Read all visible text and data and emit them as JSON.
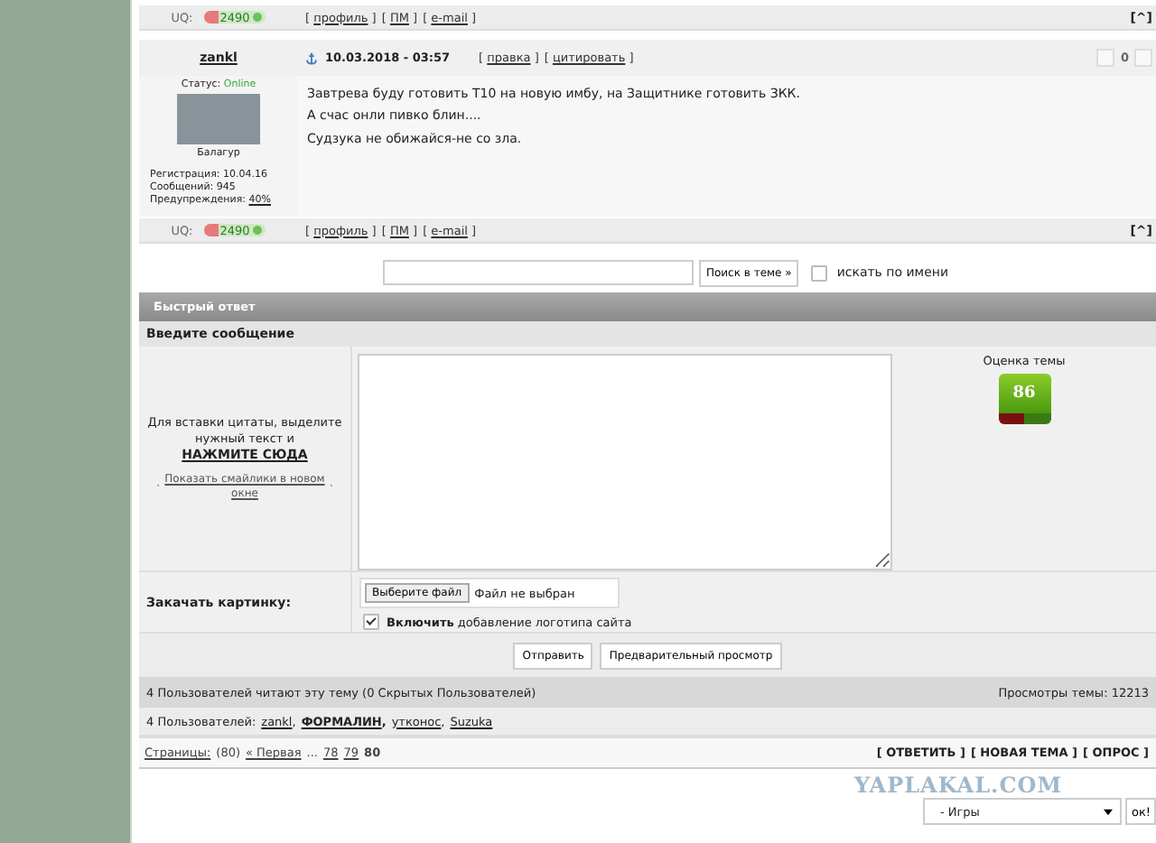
{
  "top_bar": {
    "uq_label": "UQ:",
    "rating": "2490",
    "links": [
      {
        "open": "[",
        "label": "профиль",
        "close": "]"
      },
      {
        "open": "[",
        "label": "ПМ",
        "close": "]"
      },
      {
        "open": "[",
        "label": "e-mail",
        "close": "]"
      }
    ],
    "top_link": "[^]"
  },
  "post": {
    "username": "zankl",
    "date": "10.03.2018 - 03:57",
    "actions": [
      {
        "open": "[",
        "label": "правка",
        "close": "]"
      },
      {
        "open": "[",
        "label": "цитировать",
        "close": "]"
      }
    ],
    "votes": "0",
    "status_label": "Статус:",
    "status": "Online",
    "rank": "Балагур",
    "stats": [
      "Регистрация: 10.04.16",
      "Сообщений: 945"
    ],
    "warnings_label": "Предупреждения:",
    "warnings": "40%",
    "lines": [
      "Завтрева буду готовить Т10 на новую имбу, на Защитнике готовить ЗКК.",
      "А счас онли пивко блин....",
      "Судзука не обижайся-не со зла."
    ]
  },
  "bottom_bar": {
    "uq_label": "UQ:",
    "rating": "2490",
    "links": [
      {
        "open": "[",
        "label": "профиль",
        "close": "]"
      },
      {
        "open": "[",
        "label": "ПМ",
        "close": "]"
      },
      {
        "open": "[",
        "label": "e-mail",
        "close": "]"
      }
    ],
    "top_link": "[^]"
  },
  "search": {
    "button": "Поиск в теме »",
    "by_name_checked": false,
    "by_name": "искать по имени"
  },
  "quick_reply": {
    "title": "Быстрый ответ",
    "subtitle": "Введите сообщение",
    "hint": "Для вставки цитаты, выделите нужный текст и",
    "hint_link": "НАЖМИТЕ СЮДА",
    "smiles_dot_left": "·",
    "smiles_link": "Показать смайлики в новом окне",
    "smiles_dot_right": "·",
    "rating_label": "Оценка темы",
    "rating": "86",
    "upload_label": "Закачать картинку:",
    "file_button": "Выберите файл",
    "file_status": "Файл не выбран",
    "logo_checked": true,
    "logo_text": "**Включить** добавление логотипа сайта",
    "buttons": [
      "Отправить",
      "Предварительный просмотр"
    ]
  },
  "readers": {
    "text": "4 Пользователей читают эту тему (0 Скрытых Пользователей)",
    "views": "Просмотры темы: 12213"
  },
  "users": {
    "label": "4 Пользователей:",
    "list": [
      {
        "name": "zankl",
        "bold": false,
        "sep": ","
      },
      {
        "name": "ФОРМАЛИН",
        "bold": true,
        "sep": ","
      },
      {
        "name": "утконос",
        "bold": false,
        "sep": ","
      },
      {
        "name": "Suzuka",
        "bold": false
      }
    ]
  },
  "pagination": {
    "label": "Страницы:",
    "count": "(80)",
    "first": "« Первая",
    "dots": "...",
    "pages": [
      {
        "label": "78",
        "selected": false
      },
      {
        "label": "79",
        "selected": false
      },
      {
        "label": "80",
        "selected": true
      }
    ],
    "actions": [
      "[ ОТВЕТИТЬ ]",
      "[ НОВАЯ ТЕМА ]",
      "[ ОПРОС ]"
    ]
  },
  "footer": {
    "logo": "YAPLAKAL.COM",
    "select": "- Игры",
    "go": "ок!"
  }
}
